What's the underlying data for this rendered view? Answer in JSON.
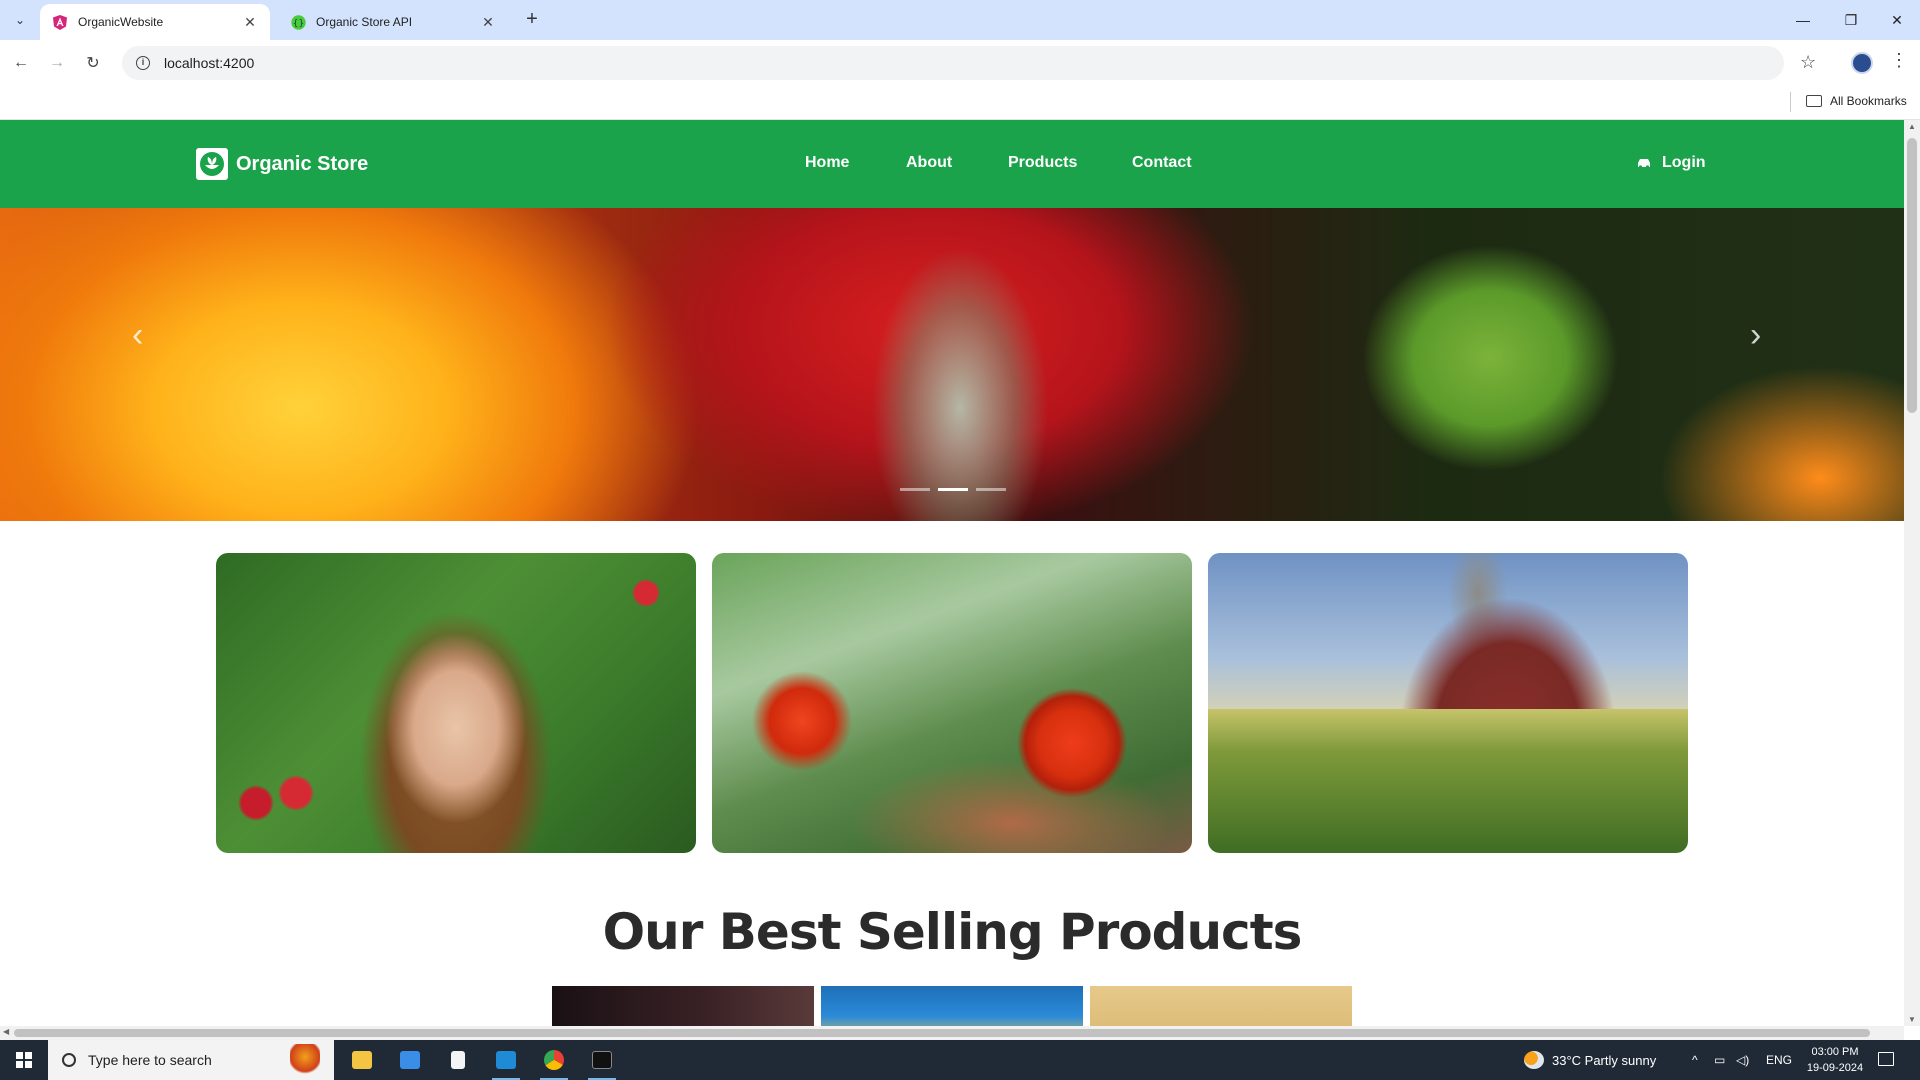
{
  "browser": {
    "tabs": [
      {
        "title": "OrganicWebsite",
        "active": true,
        "favicon": "angular-icon"
      },
      {
        "title": "Organic Store API",
        "active": false,
        "favicon": "swagger-icon"
      }
    ],
    "url": "localhost:4200",
    "bookmarks_label": "All Bookmarks"
  },
  "site": {
    "brand": "Organic Store",
    "nav": [
      "Home",
      "About",
      "Products",
      "Contact"
    ],
    "login": "Login",
    "carousel": {
      "slides": 3,
      "active_index": 1
    },
    "section_title": "Our Best Selling Products"
  },
  "taskbar": {
    "search_placeholder": "Type here to search",
    "weather": "33°C  Partly sunny",
    "language": "ENG",
    "time": "03:00 PM",
    "date": "19-09-2024"
  },
  "colors": {
    "brand_green": "#1aa34a",
    "tabbar": "#d3e3fd",
    "taskbar": "#202a36"
  }
}
